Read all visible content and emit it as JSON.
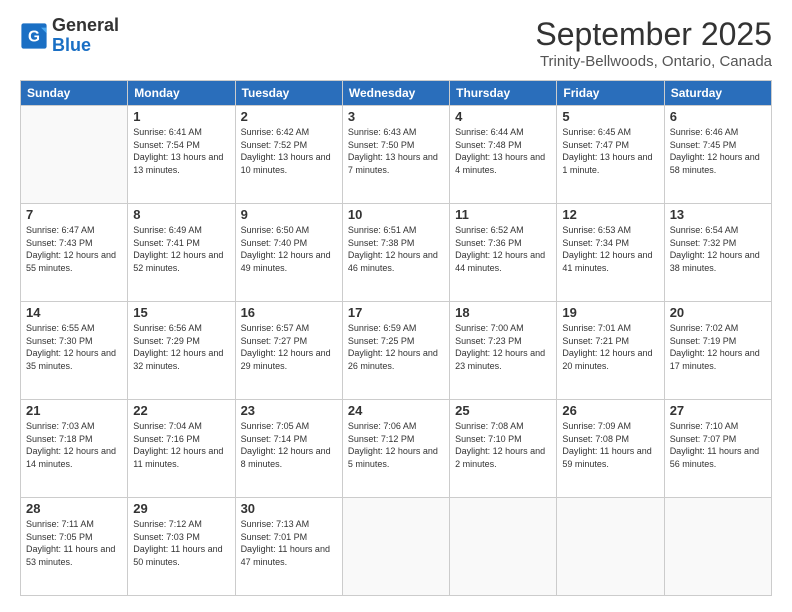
{
  "header": {
    "logo_general": "General",
    "logo_blue": "Blue",
    "month_title": "September 2025",
    "location": "Trinity-Bellwoods, Ontario, Canada"
  },
  "weekdays": [
    "Sunday",
    "Monday",
    "Tuesday",
    "Wednesday",
    "Thursday",
    "Friday",
    "Saturday"
  ],
  "weeks": [
    [
      {
        "empty": true
      },
      {
        "day": "1",
        "sunrise": "6:41 AM",
        "sunset": "7:54 PM",
        "daylight": "13 hours and 13 minutes."
      },
      {
        "day": "2",
        "sunrise": "6:42 AM",
        "sunset": "7:52 PM",
        "daylight": "13 hours and 10 minutes."
      },
      {
        "day": "3",
        "sunrise": "6:43 AM",
        "sunset": "7:50 PM",
        "daylight": "13 hours and 7 minutes."
      },
      {
        "day": "4",
        "sunrise": "6:44 AM",
        "sunset": "7:48 PM",
        "daylight": "13 hours and 4 minutes."
      },
      {
        "day": "5",
        "sunrise": "6:45 AM",
        "sunset": "7:47 PM",
        "daylight": "13 hours and 1 minute."
      },
      {
        "day": "6",
        "sunrise": "6:46 AM",
        "sunset": "7:45 PM",
        "daylight": "12 hours and 58 minutes."
      }
    ],
    [
      {
        "day": "7",
        "sunrise": "6:47 AM",
        "sunset": "7:43 PM",
        "daylight": "12 hours and 55 minutes."
      },
      {
        "day": "8",
        "sunrise": "6:49 AM",
        "sunset": "7:41 PM",
        "daylight": "12 hours and 52 minutes."
      },
      {
        "day": "9",
        "sunrise": "6:50 AM",
        "sunset": "7:40 PM",
        "daylight": "12 hours and 49 minutes."
      },
      {
        "day": "10",
        "sunrise": "6:51 AM",
        "sunset": "7:38 PM",
        "daylight": "12 hours and 46 minutes."
      },
      {
        "day": "11",
        "sunrise": "6:52 AM",
        "sunset": "7:36 PM",
        "daylight": "12 hours and 44 minutes."
      },
      {
        "day": "12",
        "sunrise": "6:53 AM",
        "sunset": "7:34 PM",
        "daylight": "12 hours and 41 minutes."
      },
      {
        "day": "13",
        "sunrise": "6:54 AM",
        "sunset": "7:32 PM",
        "daylight": "12 hours and 38 minutes."
      }
    ],
    [
      {
        "day": "14",
        "sunrise": "6:55 AM",
        "sunset": "7:30 PM",
        "daylight": "12 hours and 35 minutes."
      },
      {
        "day": "15",
        "sunrise": "6:56 AM",
        "sunset": "7:29 PM",
        "daylight": "12 hours and 32 minutes."
      },
      {
        "day": "16",
        "sunrise": "6:57 AM",
        "sunset": "7:27 PM",
        "daylight": "12 hours and 29 minutes."
      },
      {
        "day": "17",
        "sunrise": "6:59 AM",
        "sunset": "7:25 PM",
        "daylight": "12 hours and 26 minutes."
      },
      {
        "day": "18",
        "sunrise": "7:00 AM",
        "sunset": "7:23 PM",
        "daylight": "12 hours and 23 minutes."
      },
      {
        "day": "19",
        "sunrise": "7:01 AM",
        "sunset": "7:21 PM",
        "daylight": "12 hours and 20 minutes."
      },
      {
        "day": "20",
        "sunrise": "7:02 AM",
        "sunset": "7:19 PM",
        "daylight": "12 hours and 17 minutes."
      }
    ],
    [
      {
        "day": "21",
        "sunrise": "7:03 AM",
        "sunset": "7:18 PM",
        "daylight": "12 hours and 14 minutes."
      },
      {
        "day": "22",
        "sunrise": "7:04 AM",
        "sunset": "7:16 PM",
        "daylight": "12 hours and 11 minutes."
      },
      {
        "day": "23",
        "sunrise": "7:05 AM",
        "sunset": "7:14 PM",
        "daylight": "12 hours and 8 minutes."
      },
      {
        "day": "24",
        "sunrise": "7:06 AM",
        "sunset": "7:12 PM",
        "daylight": "12 hours and 5 minutes."
      },
      {
        "day": "25",
        "sunrise": "7:08 AM",
        "sunset": "7:10 PM",
        "daylight": "12 hours and 2 minutes."
      },
      {
        "day": "26",
        "sunrise": "7:09 AM",
        "sunset": "7:08 PM",
        "daylight": "11 hours and 59 minutes."
      },
      {
        "day": "27",
        "sunrise": "7:10 AM",
        "sunset": "7:07 PM",
        "daylight": "11 hours and 56 minutes."
      }
    ],
    [
      {
        "day": "28",
        "sunrise": "7:11 AM",
        "sunset": "7:05 PM",
        "daylight": "11 hours and 53 minutes."
      },
      {
        "day": "29",
        "sunrise": "7:12 AM",
        "sunset": "7:03 PM",
        "daylight": "11 hours and 50 minutes."
      },
      {
        "day": "30",
        "sunrise": "7:13 AM",
        "sunset": "7:01 PM",
        "daylight": "11 hours and 47 minutes."
      },
      {
        "empty": true
      },
      {
        "empty": true
      },
      {
        "empty": true
      },
      {
        "empty": true
      }
    ]
  ],
  "sunrise_label": "Sunrise:",
  "sunset_label": "Sunset:",
  "daylight_label": "Daylight:"
}
